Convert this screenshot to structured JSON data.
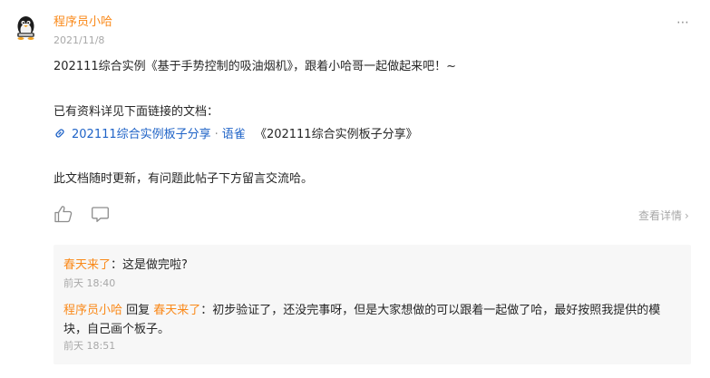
{
  "post": {
    "author": "程序员小哈",
    "date": "2021/11/8",
    "more_label": "⋯",
    "paragraph1": "202111综合实例《基于手势控制的吸油烟机》，跟着小哈哥一起做起来吧！~",
    "paragraph2": "已有资料详见下面链接的文档：",
    "link": {
      "icon": "link-icon",
      "title": "202111综合实例板子分享",
      "separator": "·",
      "source": "语雀",
      "book_title": "《202111综合实例板子分享》"
    },
    "paragraph3": "此文档随时更新，有问题此帖子下方留言交流哈。"
  },
  "actions": {
    "like_icon": "thumb-up-icon",
    "comment_icon": "comment-icon",
    "details_label": "查看详情",
    "details_chevron": "›"
  },
  "comments": [
    {
      "name": "春天来了",
      "text": "：这是做完啦?",
      "time": "前天 18:40"
    },
    {
      "name": "程序员小哈",
      "reply_word": " 回复 ",
      "reply_to": "春天来了",
      "text": "：初步验证了，还没完事呀，但是大家想做的可以跟着一起做了哈，最好按照我提供的模块，自己画个板子。",
      "time": "前天 18:51"
    }
  ],
  "colors": {
    "accent": "#fa8919",
    "link": "#1f63c7",
    "muted": "#a8a8a8",
    "comment_bg": "#f7f7f7"
  }
}
